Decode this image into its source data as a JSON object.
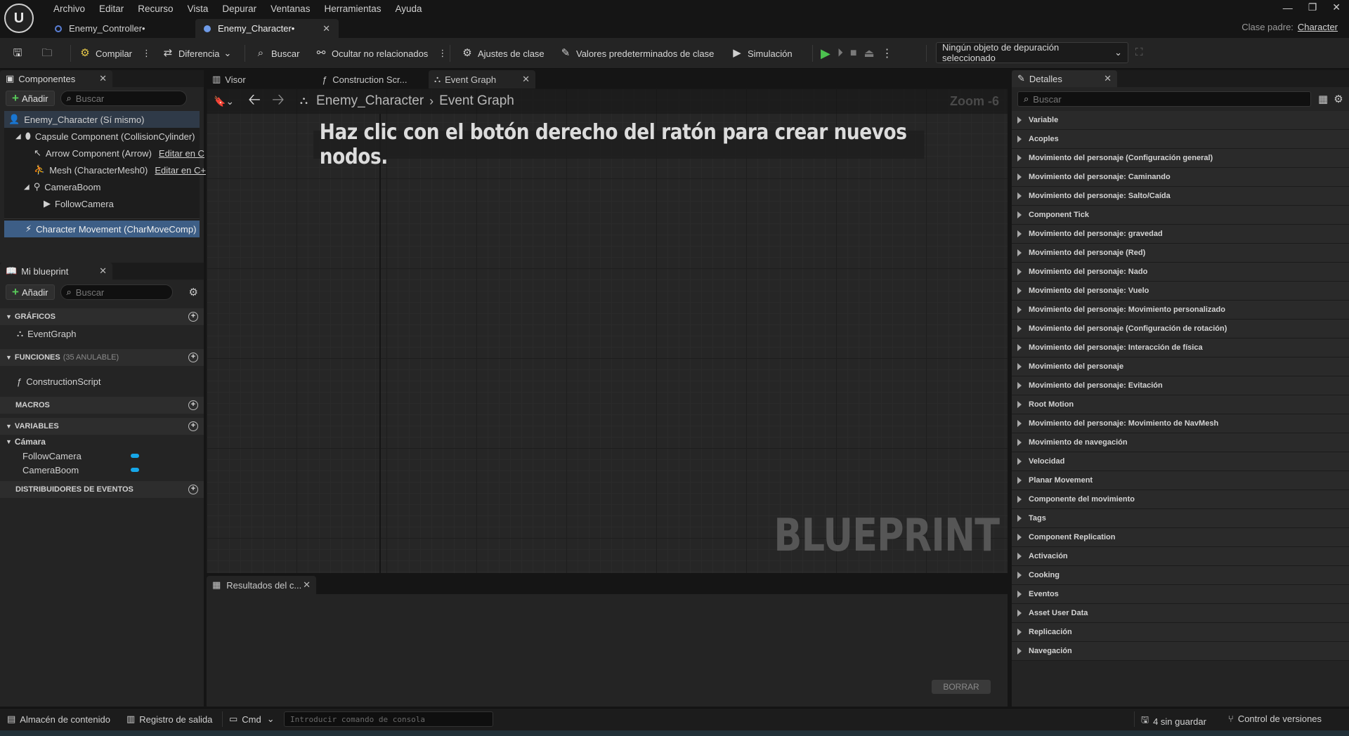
{
  "menu": [
    "Archivo",
    "Editar",
    "Recurso",
    "Vista",
    "Depurar",
    "Ventanas",
    "Herramientas",
    "Ayuda"
  ],
  "doc_tabs": [
    {
      "label": "Enemy_Controller•"
    },
    {
      "label": "Enemy_Character•"
    }
  ],
  "parent_class": {
    "label": "Clase padre:",
    "value": "Character"
  },
  "toolbar": {
    "compile": "Compilar",
    "diff": "Diferencia",
    "find": "Buscar",
    "hide_unrelated": "Ocultar no relacionados",
    "class_settings": "Ajustes de clase",
    "class_defaults": "Valores predeterminados de clase",
    "simulation": "Simulación",
    "debug_select": "Ningún objeto de depuración seleccionado"
  },
  "components": {
    "tab": "Componentes",
    "add": "Añadir",
    "search_placeholder": "Buscar",
    "items": [
      {
        "label": "Enemy_Character (Sí mismo)"
      },
      {
        "label": "Capsule Component (CollisionCylinder)"
      },
      {
        "label": "Arrow Component (Arrow)",
        "link": "Editar en C"
      },
      {
        "label": "Mesh (CharacterMesh0)",
        "link": "Editar en C+"
      },
      {
        "label": "CameraBoom"
      },
      {
        "label": "FollowCamera"
      },
      {
        "label": "Character Movement (CharMoveComp)"
      }
    ]
  },
  "my_blueprint": {
    "tab": "Mi blueprint",
    "add": "Añadir",
    "search_placeholder": "Buscar",
    "graphs": "GRÁFICOS",
    "event_graph": "EventGraph",
    "functions": "FUNCIONES",
    "functions_count": "(35 ANULABLE)",
    "construction_script": "ConstructionScript",
    "macros": "MACROS",
    "variables": "VARIABLES",
    "camera_category": "Cámara",
    "var1": "FollowCamera",
    "var2": "CameraBoom",
    "dispatchers": "DISTRIBUIDORES DE EVENTOS"
  },
  "graph_tabs": [
    "Visor",
    "Construction Scr...",
    "Event Graph"
  ],
  "graph": {
    "breadcrumb_root": "Enemy_Character",
    "breadcrumb_leaf": "Event Graph",
    "zoom": "Zoom -6",
    "hint": "Haz clic con el botón derecho del ratón para crear nuevos nodos.",
    "watermark": "BLUEPRINT"
  },
  "results": {
    "tab": "Resultados del c...",
    "clear": "BORRAR"
  },
  "details": {
    "tab": "Detalles",
    "search_placeholder": "Buscar",
    "categories": [
      "Variable",
      "Acoples",
      "Movimiento del personaje (Configuración general)",
      "Movimiento del personaje: Caminando",
      "Movimiento del personaje: Salto/Caída",
      "Component Tick",
      "Movimiento del personaje: gravedad",
      "Movimiento del personaje (Red)",
      "Movimiento del personaje: Nado",
      "Movimiento del personaje: Vuelo",
      "Movimiento del personaje: Movimiento personalizado",
      "Movimiento del personaje (Configuración de rotación)",
      "Movimiento del personaje: Interacción de física",
      "Movimiento del personaje",
      "Movimiento del personaje: Evitación",
      "Root Motion",
      "Movimiento del personaje: Movimiento de NavMesh",
      "Movimiento de navegación",
      "Velocidad",
      "Planar Movement",
      "Componente del movimiento",
      "Tags",
      "Component Replication",
      "Activación",
      "Cooking",
      "Eventos",
      "Asset User Data",
      "Replicación",
      "Navegación"
    ]
  },
  "statusbar": {
    "content": "Almacén de contenido",
    "output": "Registro de salida",
    "cmd": "Cmd",
    "console_placeholder": "Introducir comando de consola",
    "unsaved": "4 sin guardar",
    "version_control": "Control de versiones"
  }
}
